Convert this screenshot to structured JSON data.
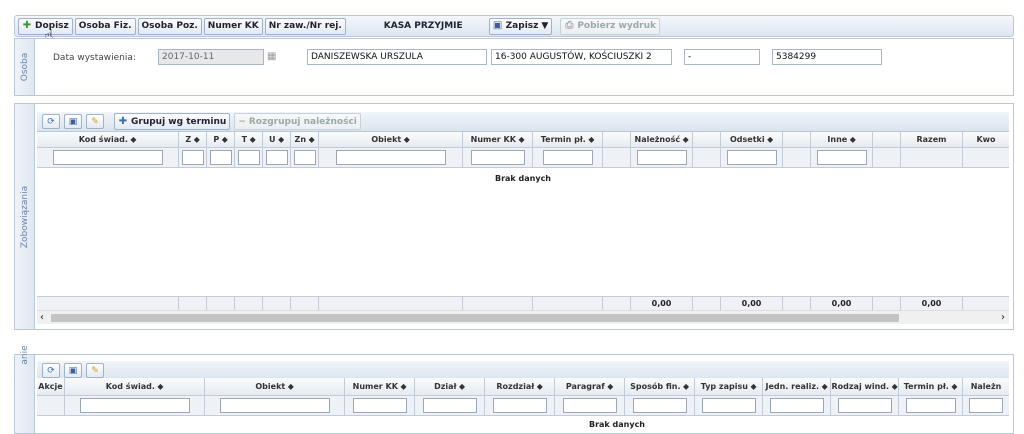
{
  "toolbar": {
    "add_label": "Dopisz",
    "btn_fiz": "Osoba Fiz.",
    "btn_poz": "Osoba Poz.",
    "btn_kk": "Numer KK",
    "btn_zaw": "Nr zaw./Nr rej.",
    "kasa_label": "KASA PRZYJMIE",
    "save_label": "Zapisz",
    "print_label": "Pobierz wydruk"
  },
  "osoba": {
    "tab_label": "Osoba",
    "date_label": "Data wystawienia:",
    "date_value": "2017-10-11",
    "name_value": "DANISZEWSKA URSZULA",
    "address_value": "16-300 AUGUSTÓW, KOŚCIUSZKI 2",
    "dash_value": "-",
    "number_value": "5384299"
  },
  "zob": {
    "tab_label": "Zobowiązania",
    "group_label": "Grupuj wg terminu",
    "ungroup_label": "Rozgrupuj należności",
    "columns": [
      "Kod świad. ⬥",
      "Z ⬥",
      "P ⬥",
      "T ⬥",
      "U ⬥",
      "Zn ⬥",
      "Obiekt ⬥",
      "Numer KK ⬥",
      "Termin pł. ⬥",
      "",
      "Należność ⬥",
      "",
      "Odsetki ⬥",
      "",
      "Inne ⬥",
      "",
      "Razem",
      "Kwo"
    ],
    "empty": "Brak danych",
    "totals": [
      "0,00",
      "0,00",
      "0,00",
      "0,00"
    ]
  },
  "dolne": {
    "tab_label": "anie",
    "columns": [
      "Akcje",
      "Kod świad. ⬥",
      "Obiekt ⬥",
      "Numer KK ⬥",
      "Dział ⬥",
      "Rozdział ⬥",
      "Paragraf ⬥",
      "Sposób fin. ⬥",
      "Typ zapisu ⬥",
      "Jedn. realiz. ⬥",
      "Rodzaj wind. ⬥",
      "Termin pł. ⬥",
      "Należn"
    ],
    "empty": "Brak danych"
  },
  "colors": {
    "accent": "#b9c8d9",
    "tab_text": "#6a86a8"
  }
}
